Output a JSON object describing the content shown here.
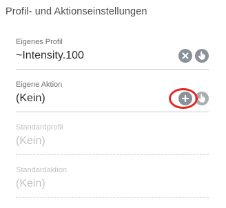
{
  "panel": {
    "title": "Profil- und Aktionseinstellungen"
  },
  "fields": [
    {
      "label": "Eigenes Profil",
      "value": "~Intensity.100",
      "enabled": true,
      "actions": [
        "clear-icon",
        "hand-pointer-icon"
      ]
    },
    {
      "label": "Eigene Aktion",
      "value": "(Kein)",
      "enabled": true,
      "actions": [
        "add-icon",
        "hand-pointer-icon"
      ]
    },
    {
      "label": "Standardprofil",
      "value": "(Kein)",
      "enabled": false
    },
    {
      "label": "Standardaktion",
      "value": "(Kein)",
      "enabled": false
    }
  ],
  "colors": {
    "icon_bg": "#8b9199",
    "highlight": "#e52620",
    "disabled_text": "#c2c2c2"
  }
}
